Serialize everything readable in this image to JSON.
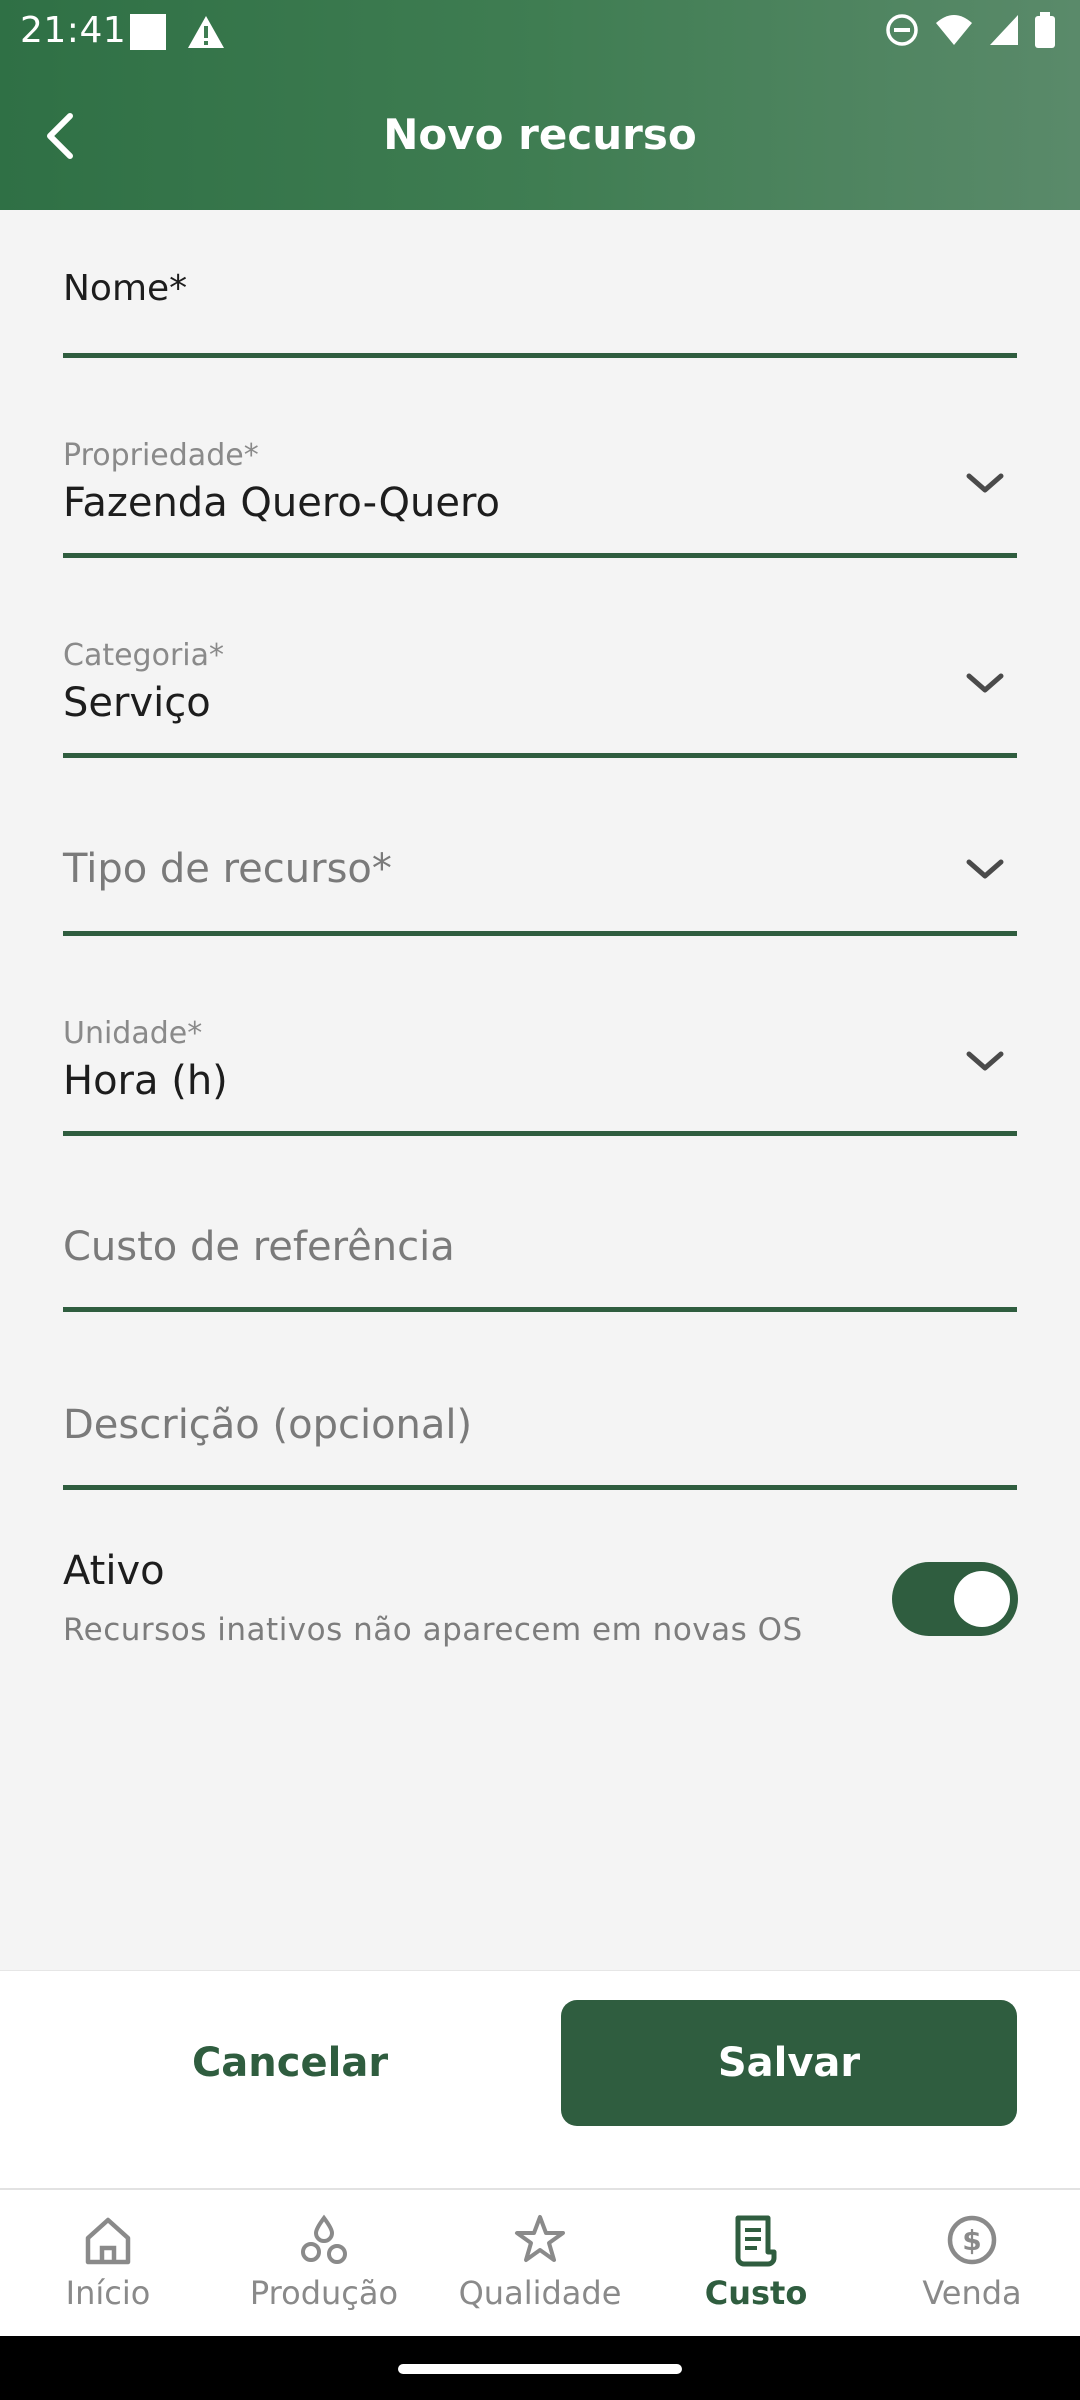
{
  "status_bar": {
    "time": "21:41"
  },
  "header": {
    "title": "Novo recurso"
  },
  "form": {
    "nome": {
      "label": "Nome*",
      "value": ""
    },
    "propriedade": {
      "label": "Propriedade*",
      "value": "Fazenda Quero-Quero"
    },
    "categoria": {
      "label": "Categoria*",
      "value": "Serviço"
    },
    "tipo": {
      "placeholder": "Tipo de recurso*"
    },
    "unidade": {
      "label": "Unidade*",
      "value": "Hora (h)"
    },
    "custo": {
      "placeholder": "Custo de referência"
    },
    "descricao": {
      "placeholder": "Descrição (opcional)"
    },
    "ativo": {
      "label": "Ativo",
      "description": "Recursos inativos não aparecem em novas OS",
      "enabled": true
    }
  },
  "actions": {
    "cancel": "Cancelar",
    "save": "Salvar"
  },
  "bottom_nav": {
    "items": [
      {
        "label": "Início",
        "icon": "home-icon"
      },
      {
        "label": "Produção",
        "icon": "drops-icon"
      },
      {
        "label": "Qualidade",
        "icon": "star-icon"
      },
      {
        "label": "Custo",
        "icon": "receipt-icon",
        "active": true
      },
      {
        "label": "Venda",
        "icon": "dollar-circle-icon"
      }
    ]
  },
  "colors": {
    "accent": "#2f5d3f",
    "header": "#3f7d52",
    "background": "#f4f4f4"
  }
}
